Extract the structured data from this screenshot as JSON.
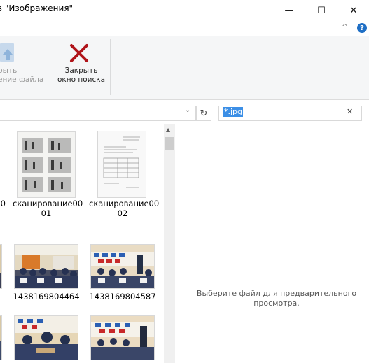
{
  "window": {
    "title": "в \"Изображения\"",
    "minimize_glyph": "—",
    "maximize_glyph": "☐",
    "close_glyph": "✕"
  },
  "ribbon": {
    "collapse_glyph": "^",
    "help_glyph": "?",
    "open_location": {
      "line1": "рыть",
      "line2": "ение файла",
      "icon": "up-arrow-icon"
    },
    "close_search": {
      "line1": "Закрыть",
      "line2": "окно поиска",
      "icon": "red-x-icon",
      "color": "#b0141a"
    }
  },
  "address": {
    "dropdown_glyph": "⌄",
    "refresh_glyph": "↻"
  },
  "search": {
    "query": "*.jpg",
    "clear_glyph": "✕"
  },
  "files": [
    {
      "name_line1": "0",
      "name_line2": "",
      "kind": "document"
    },
    {
      "name_line1": "сканирование00",
      "name_line2": "01",
      "kind": "document"
    },
    {
      "name_line1": "сканирование00",
      "name_line2": "02",
      "kind": "document"
    },
    {
      "name_line1": "",
      "name_line2": "",
      "kind": "photo"
    },
    {
      "name_line1": "1438169804464",
      "name_line2": "",
      "kind": "photo"
    },
    {
      "name_line1": "1438169804587",
      "name_line2": "",
      "kind": "photo"
    },
    {
      "name_line1": "",
      "name_line2": "",
      "kind": "photo"
    },
    {
      "name_line1": "",
      "name_line2": "",
      "kind": "photo"
    },
    {
      "name_line1": "",
      "name_line2": "",
      "kind": "photo"
    }
  ],
  "preview": {
    "message_line1": "Выберите файл для предварительного",
    "message_line2": "просмотра."
  },
  "colors": {
    "accent": "#3c8fe6",
    "ribbon_bg": "#f5f6f7",
    "close_search_red": "#b0141a"
  }
}
